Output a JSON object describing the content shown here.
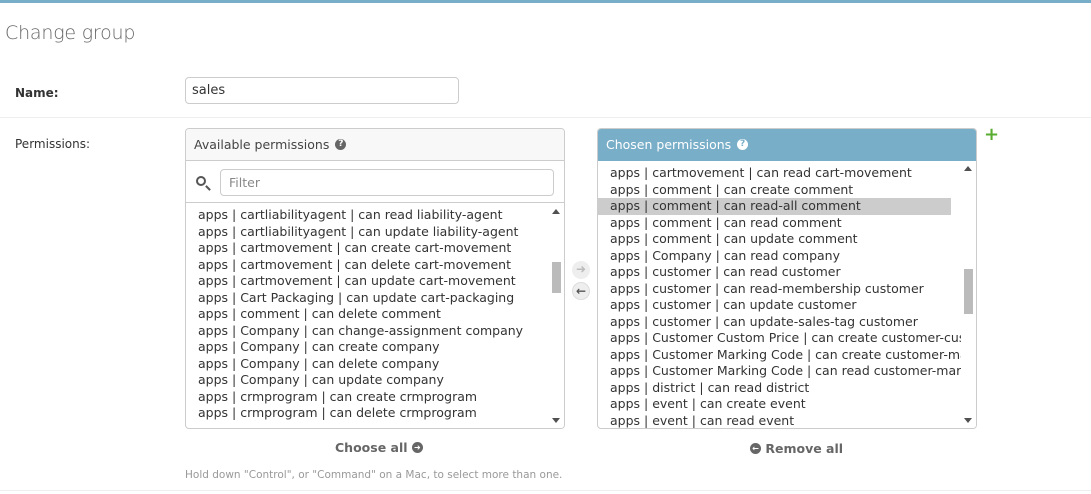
{
  "header": {
    "title": "Change group"
  },
  "name_field": {
    "label": "Name:",
    "value": "sales"
  },
  "permissions": {
    "label": "Permissions:",
    "available": {
      "title": "Available permissions",
      "help_icon": "question-circle-icon",
      "filter_placeholder": "Filter",
      "items": [
        "apps | cartliabilityagent | can read liability-agent",
        "apps | cartliabilityagent | can update liability-agent",
        "apps | cartmovement | can create cart-movement",
        "apps | cartmovement | can delete cart-movement",
        "apps | cartmovement | can update cart-movement",
        "apps | Cart Packaging | can update cart-packaging",
        "apps | comment | can delete comment",
        "apps | Company | can change-assignment company",
        "apps | Company | can create company",
        "apps | Company | can delete company",
        "apps | Company | can update company",
        "apps | crmprogram | can create crmprogram",
        "apps | crmprogram | can delete crmprogram"
      ]
    },
    "chosen": {
      "title": "Chosen permissions",
      "help_icon": "question-circle-icon",
      "selected_item": "apps | comment | can read-all comment",
      "items": [
        "apps | cartmovement | can read cart-movement",
        "apps | comment | can create comment",
        "apps | comment | can read-all comment",
        "apps | comment | can read comment",
        "apps | comment | can update comment",
        "apps | Company | can read company",
        "apps | customer | can read customer",
        "apps | customer | can read-membership customer",
        "apps | customer | can update customer",
        "apps | customer | can update-sales-tag customer",
        "apps | Customer Custom Price | can create customer-custom",
        "apps | Customer Marking Code | can create customer-marking",
        "apps | Customer Marking Code | can read customer-marking-",
        "apps | district | can read district",
        "apps | event | can create event",
        "apps | event | can read event"
      ]
    },
    "choose_all_label": "Choose all",
    "remove_all_label": "Remove all",
    "add_icon": "plus-icon",
    "help_text": "Hold down \"Control\", or \"Command\" on a Mac, to select more than one."
  },
  "colors": {
    "accent": "#79aec8",
    "add": "#5aab31",
    "selected_row": "#cccccc"
  }
}
